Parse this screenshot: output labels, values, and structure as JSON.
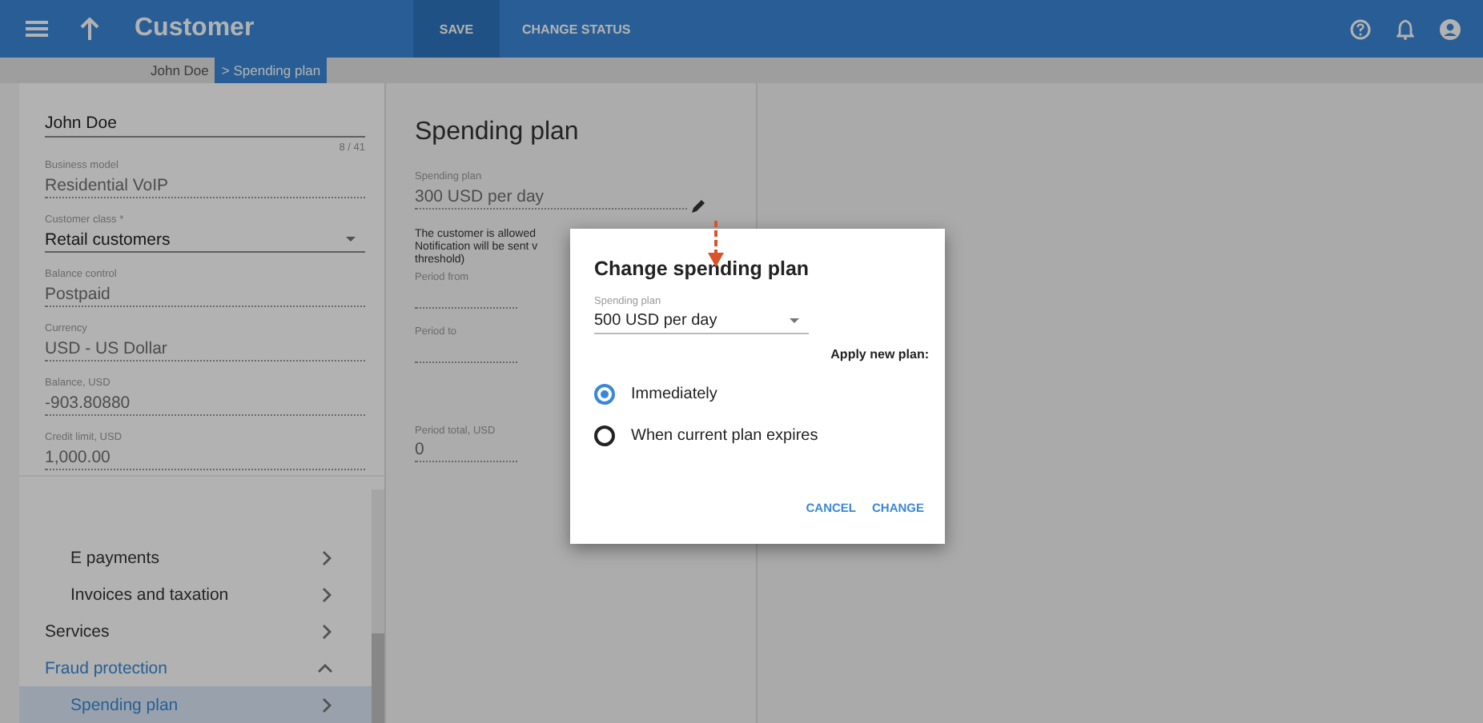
{
  "app_bar": {
    "title": "Customer",
    "actions": [
      {
        "label": "SAVE",
        "selected": true
      },
      {
        "label": "CHANGE STATUS",
        "selected": false
      }
    ]
  },
  "breadcrumbs": [
    {
      "label": "John Doe",
      "selected": false
    },
    {
      "label": "> Spending plan",
      "selected": true
    }
  ],
  "sidebar": {
    "fields": [
      {
        "kind": "text",
        "value": "John Doe",
        "counter": "8 / 41",
        "readonly": false
      },
      {
        "kind": "text",
        "label": "Business model",
        "value": "Residential VoIP",
        "readonly": true
      },
      {
        "kind": "select",
        "label": "Customer class *",
        "value": "Retail customers",
        "readonly": false
      },
      {
        "kind": "text",
        "label": "Balance control",
        "value": "Postpaid",
        "readonly": true
      },
      {
        "kind": "text",
        "label": "Currency",
        "value": "USD - US Dollar",
        "readonly": true
      },
      {
        "kind": "text",
        "label": "Balance, USD",
        "value": "-903.80880",
        "readonly": true
      },
      {
        "kind": "text",
        "label": "Credit limit, USD",
        "value": "1,000.00",
        "readonly": true
      }
    ],
    "nav": [
      {
        "label": "E payments",
        "selected": false,
        "expanded": false
      },
      {
        "label": "Invoices and taxation",
        "selected": false,
        "expanded": false
      }
    ],
    "nav_top": [
      {
        "label": "Services",
        "selected": false,
        "expanded": false
      },
      {
        "label": "Fraud protection",
        "selected": false,
        "expanded": true,
        "children": [
          {
            "label": "Spending plan",
            "selected": true
          }
        ]
      }
    ]
  },
  "content": {
    "title": "Spending plan",
    "plan_field": {
      "label": "Spending plan",
      "value": "300 USD per day"
    },
    "note": "The customer is allowed\nNotification will be sent v\nthreshold)",
    "fields": [
      {
        "label": "Period from"
      },
      {
        "label": "Period to"
      },
      {
        "label": "Period total, USD",
        "value": "0"
      }
    ]
  },
  "dialog": {
    "title": "Change spending plan",
    "field": {
      "label": "Spending plan",
      "value": "500 USD per day"
    },
    "apply_label": "Apply new plan:",
    "options": [
      {
        "label": "Immediately",
        "selected": true
      },
      {
        "label": "When current plan expires",
        "selected": false
      }
    ],
    "buttons": [
      "CANCEL",
      "CHANGE"
    ]
  }
}
